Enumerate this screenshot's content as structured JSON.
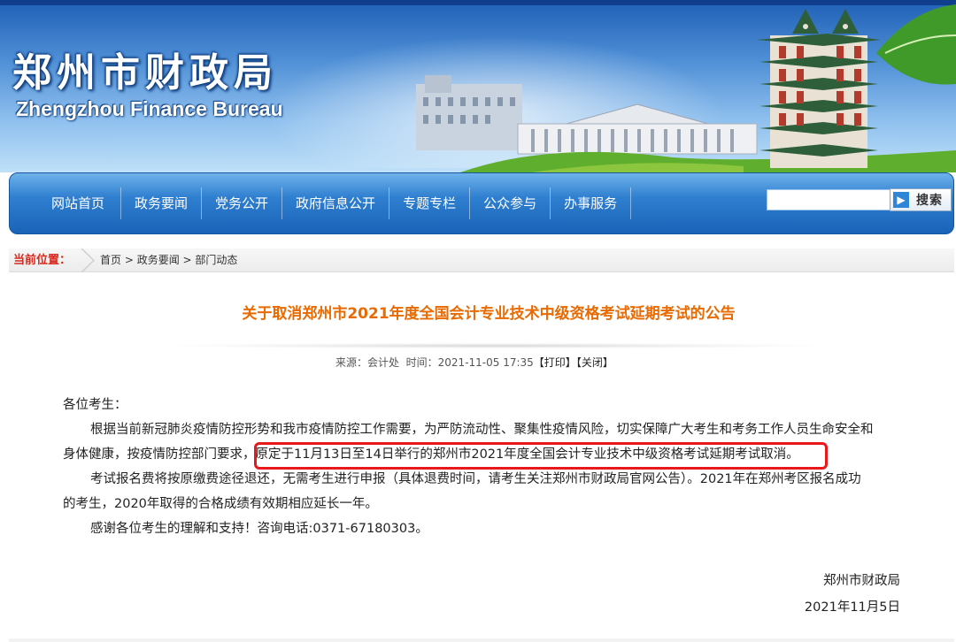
{
  "header": {
    "title_cn": "郑州市财政局",
    "title_en": "Zhengzhou Finance Bureau"
  },
  "nav": {
    "items": [
      "网站首页",
      "政务要闻",
      "党务公开",
      "政府信息公开",
      "专题专栏",
      "公众参与",
      "办事服务"
    ],
    "search_placeholder": "",
    "search_button": "搜索"
  },
  "breadcrumb": {
    "label": "当前位置：",
    "links": [
      "首页",
      "政务要闻",
      "部门动态"
    ],
    "separator": " > "
  },
  "article": {
    "title": "关于取消郑州市2021年度全国会计专业技术中级资格考试延期考试的公告",
    "meta": {
      "source": "来源：会计处",
      "time": "时间：2021-11-05 17:35",
      "print": "【打印】",
      "close": "【关闭】"
    },
    "salutation": "各位考生：",
    "p1_line1": "根据当前新冠肺炎疫情防控形势和我市疫情防控工作需要，为严防流动性、聚集性疫情风险，切实保障广大考生和考务工作人员生命安全和",
    "p1_line2_a": "身体健康，按疫情防控部门要求，",
    "p1_line2_b": "原定于11月13日至14日举行的郑州市2021年度全国会计专业技术中级资格考试延期考试取消。",
    "p2_line1": "考试报名费将按原缴费途径退还，无需考生进行申报（具体退费时间，请考生关注郑州市财政局官网公告）。2021年在郑州考区报名成功",
    "p2_line2": "的考生，2020年取得的合格成绩有效期相应延长一年。",
    "p3": "感谢各位考生的理解和支持！咨询电话:0371-67180303。",
    "signature": "郑州市财政局",
    "date": "2021年11月5日"
  },
  "colors": {
    "accent_title": "#e96a00",
    "breadcrumb_label": "#d9271c",
    "highlight_box": "#e8181c",
    "nav_blue": "#1a63b8"
  }
}
